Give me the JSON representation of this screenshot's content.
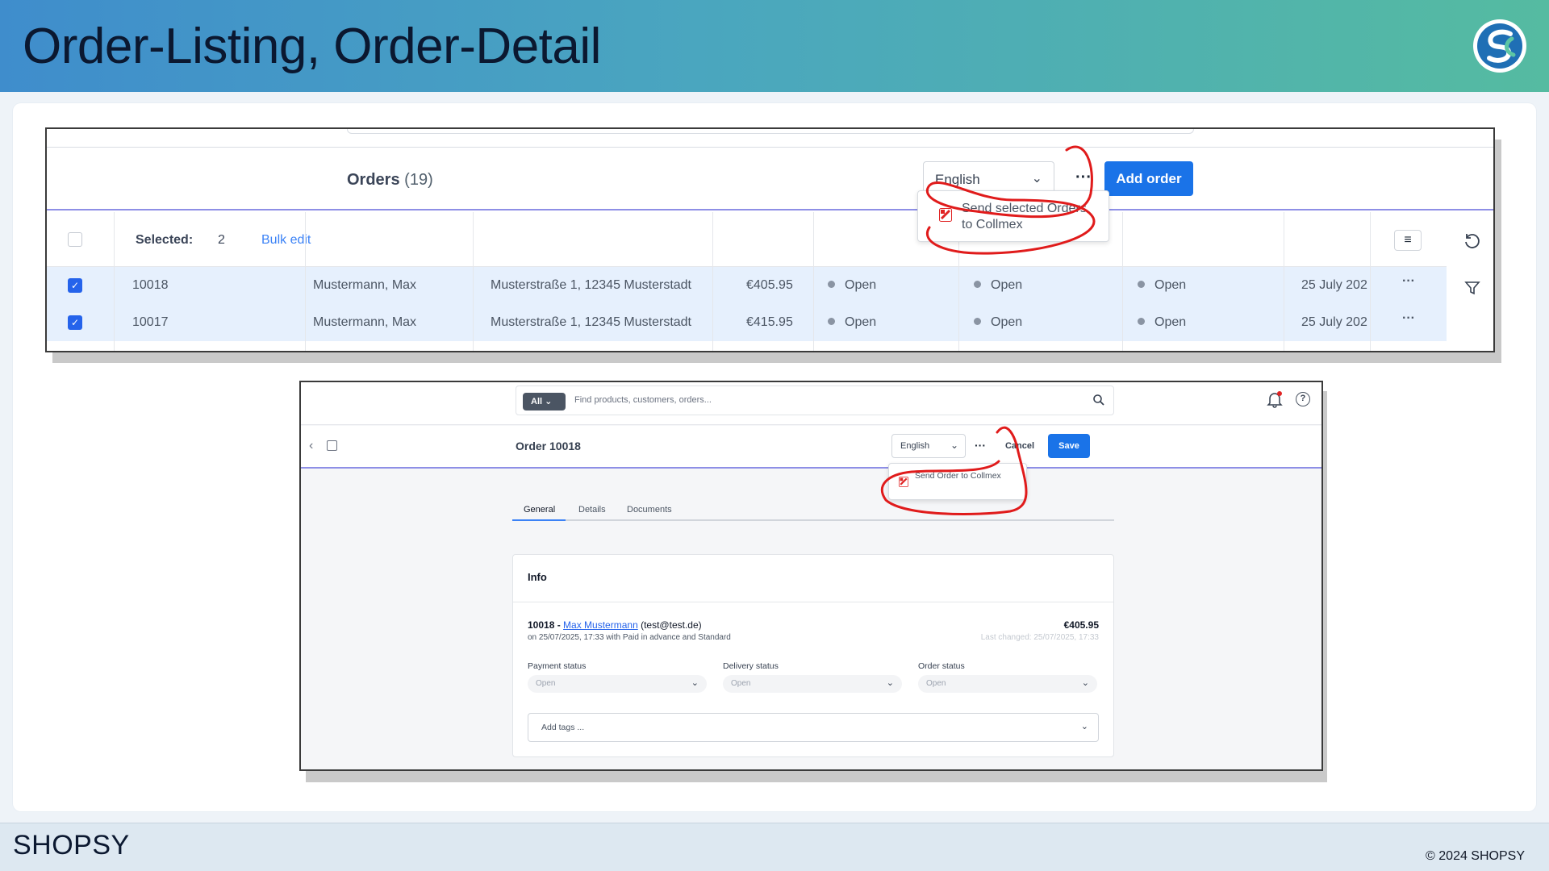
{
  "slide": {
    "title": "Order-Listing, Order-Detail",
    "footer_brand": "SHOPSY",
    "copyright": "© 2024 SHOPSY"
  },
  "listing": {
    "title": "Orders",
    "count": "(19)",
    "language": "English",
    "more_label": "···",
    "add_order": "Add order",
    "popup_action": "Send selected Orders to Collmex",
    "selected_label": "Selected:",
    "selected_count": "2",
    "bulk_edit": "Bulk edit",
    "rows": [
      {
        "id": "10018",
        "customer": "Mustermann, Max",
        "address": "Musterstraße 1, 12345 Musterstadt",
        "amount": "€405.95",
        "status1": "Open",
        "status2": "Open",
        "status3": "Open",
        "date": "25 July 202"
      },
      {
        "id": "10017",
        "customer": "Mustermann, Max",
        "address": "Musterstraße 1, 12345 Musterstadt",
        "amount": "€415.95",
        "status1": "Open",
        "status2": "Open",
        "status3": "Open",
        "date": "25 July 202"
      }
    ]
  },
  "detail": {
    "search_scope": "All",
    "search_placeholder": "Find products, customers, orders...",
    "title": "Order 10018",
    "language": "English",
    "cancel": "Cancel",
    "save": "Save",
    "popup_action": "Send Order to Collmex",
    "tabs": [
      "General",
      "Details",
      "Documents"
    ],
    "info_title": "Info",
    "order_id": "10018 -",
    "customer_name": "Max Mustermann",
    "customer_email": "(test@test.de)",
    "order_meta": "on 25/07/2025, 17:33 with Paid in advance and Standard",
    "amount": "€405.95",
    "last_changed": "Last changed: 25/07/2025, 17:33",
    "payment_status_label": "Payment status",
    "payment_status": "Open",
    "delivery_status_label": "Delivery status",
    "delivery_status": "Open",
    "order_status_label": "Order status",
    "order_status": "Open",
    "tags_placeholder": "Add tags ..."
  },
  "colors": {
    "primary": "#1a73e8",
    "annotation": "#e01b1b",
    "selected_row": "#e6f0fd"
  }
}
